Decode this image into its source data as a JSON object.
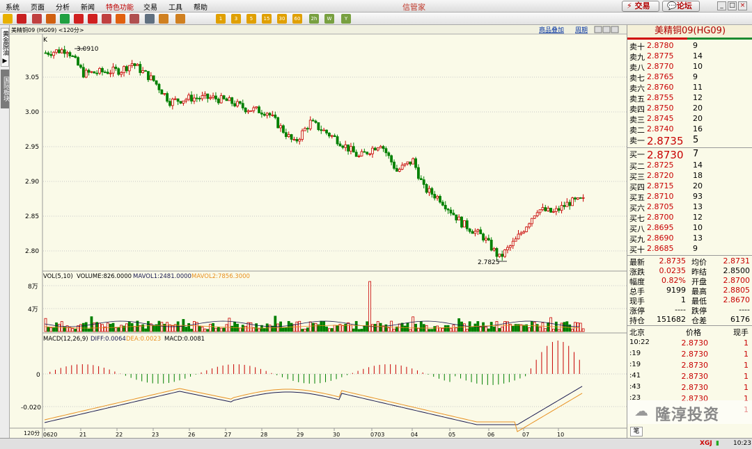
{
  "menu": [
    "系统",
    "页面",
    "分析",
    "新闻",
    "特色功能",
    "交易",
    "工具",
    "帮助"
  ],
  "app_title": "信管家",
  "top_buttons": {
    "trade": "交易",
    "forum": "论坛"
  },
  "window_controls": [
    "_",
    "□",
    "×"
  ],
  "toolbar_icons": [
    "back-icon",
    "home-icon",
    "chart-icon",
    "video-icon",
    "refresh-icon",
    "zoom-in-icon",
    "zoom-out-icon",
    "pen-icon",
    "wizard-icon",
    "filter-icon",
    "list-icon",
    "notes-icon",
    "tick-icon",
    "period-1-icon",
    "period-3-icon",
    "period-5-icon",
    "period-15-icon",
    "period-30-icon",
    "period-60-icon",
    "period-120-icon",
    "week-icon",
    "year-icon"
  ],
  "toolbar_labels": [
    "",
    "",
    "",
    "",
    "",
    "",
    "",
    "",
    "",
    "",
    "",
    "",
    "",
    "1",
    "3",
    "5",
    "15",
    "30",
    "60",
    "2h",
    "W",
    "Y"
  ],
  "sidebar": {
    "tab1": "黄金原油 ▶",
    "tab2": "国际板块"
  },
  "chart": {
    "header": "美精铜09 (HG09) <120分>",
    "header_links": {
      "overlay": "商品叠加",
      "period": "周期"
    },
    "main_label": "K",
    "price_ticks": [
      "3.05",
      "3.00",
      "2.95",
      "2.90",
      "2.85",
      "2.80"
    ],
    "high_marker": "3.0910",
    "low_marker": "2.7825",
    "vol_legend": {
      "title": "VOL(5,10)",
      "volume": "VOLUME:826.0000",
      "mavol1": "MAVOL1:2481.0000",
      "mavol2": "MAVOL2:7856.3000"
    },
    "vol_ticks": [
      "8万",
      "4万"
    ],
    "macd_legend": {
      "title": "MACD(12,26,9)",
      "diff": "DIFF:0.0064",
      "dea": "DEA:0.0023",
      "macd": "MACD:0.0081"
    },
    "macd_ticks": [
      "0",
      "-0.020"
    ],
    "period_label": "120分",
    "date_labels": [
      "0620",
      "21",
      "22",
      "23",
      "26",
      "27",
      "28",
      "29",
      "30",
      "0703",
      "04",
      "05",
      "06",
      "07",
      "10"
    ],
    "colors": {
      "up": "#c80000",
      "down": "#008000",
      "diff": "#1a1a50",
      "dea": "#e89020"
    }
  },
  "quote": {
    "title": "美精铜09(HG09)",
    "asks": [
      {
        "label": "卖十",
        "price": "2.8780",
        "vol": "9"
      },
      {
        "label": "卖九",
        "price": "2.8775",
        "vol": "14"
      },
      {
        "label": "卖八",
        "price": "2.8770",
        "vol": "10"
      },
      {
        "label": "卖七",
        "price": "2.8765",
        "vol": "9"
      },
      {
        "label": "卖六",
        "price": "2.8760",
        "vol": "11"
      },
      {
        "label": "卖五",
        "price": "2.8755",
        "vol": "12"
      },
      {
        "label": "卖四",
        "price": "2.8750",
        "vol": "20"
      },
      {
        "label": "卖三",
        "price": "2.8745",
        "vol": "20"
      },
      {
        "label": "卖二",
        "price": "2.8740",
        "vol": "16"
      },
      {
        "label": "卖一",
        "price": "2.8735",
        "vol": "5"
      }
    ],
    "bids": [
      {
        "label": "买一",
        "price": "2.8730",
        "vol": "7"
      },
      {
        "label": "买二",
        "price": "2.8725",
        "vol": "14"
      },
      {
        "label": "买三",
        "price": "2.8720",
        "vol": "18"
      },
      {
        "label": "买四",
        "price": "2.8715",
        "vol": "20"
      },
      {
        "label": "买五",
        "price": "2.8710",
        "vol": "93"
      },
      {
        "label": "买六",
        "price": "2.8705",
        "vol": "13"
      },
      {
        "label": "买七",
        "price": "2.8700",
        "vol": "12"
      },
      {
        "label": "买八",
        "price": "2.8695",
        "vol": "10"
      },
      {
        "label": "买九",
        "price": "2.8690",
        "vol": "13"
      },
      {
        "label": "买十",
        "price": "2.8685",
        "vol": "9"
      }
    ],
    "stats": [
      {
        "l1": "最新",
        "v1": "2.8735",
        "l2": "均价",
        "v2": "2.8731"
      },
      {
        "l1": "涨跌",
        "v1": "0.0235",
        "l2": "昨结",
        "v2": "2.8500"
      },
      {
        "l1": "幅度",
        "v1": "0.82%",
        "l2": "开盘",
        "v2": "2.8700"
      },
      {
        "l1": "总手",
        "v1": "9199",
        "l2": "最高",
        "v2": "2.8805"
      },
      {
        "l1": "现手",
        "v1": "1",
        "l2": "最低",
        "v2": "2.8670"
      },
      {
        "l1": "涨停",
        "v1": "----",
        "l2": "跌停",
        "v2": "----"
      },
      {
        "l1": "持仓",
        "v1": "151682",
        "l2": "仓差",
        "v2": "6176"
      }
    ],
    "ticks_header": {
      "time": "北京",
      "price": "价格",
      "vol": "现手"
    },
    "ticks": [
      {
        "time": "10:22",
        "price": "2.8730",
        "vol": "1"
      },
      {
        "time": ":19",
        "price": "2.8730",
        "vol": "1"
      },
      {
        "time": ":19",
        "price": "2.8730",
        "vol": "1"
      },
      {
        "time": ":41",
        "price": "2.8730",
        "vol": "1"
      },
      {
        "time": ":43",
        "price": "2.8730",
        "vol": "1"
      },
      {
        "time": ":23",
        "price": "2.8730",
        "vol": "1"
      },
      {
        "time": "",
        "price": "",
        "vol": "1"
      }
    ],
    "watermark": "隆淳投资",
    "bottom_tab": "笔"
  },
  "status": {
    "logo": "XGJ",
    "time": "10:23"
  }
}
